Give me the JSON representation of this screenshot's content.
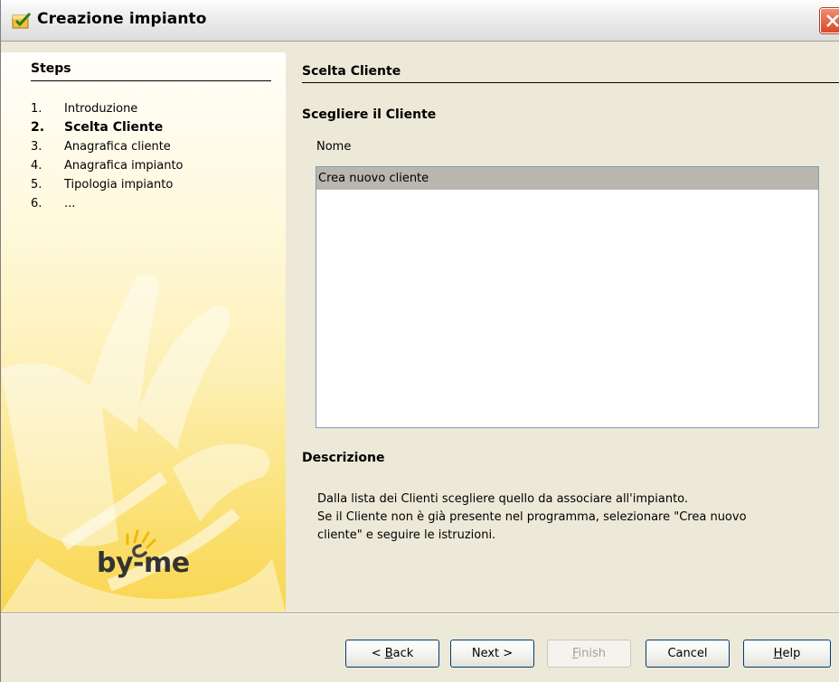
{
  "window": {
    "title": "Creazione impianto"
  },
  "steps": {
    "heading": "Steps",
    "items": [
      {
        "num": "1.",
        "label": "Introduzione",
        "active": false
      },
      {
        "num": "2.",
        "label": "Scelta Cliente",
        "active": true
      },
      {
        "num": "3.",
        "label": "Anagrafica cliente",
        "active": false
      },
      {
        "num": "4.",
        "label": "Anagrafica impianto",
        "active": false
      },
      {
        "num": "5.",
        "label": "Tipologia impianto",
        "active": false
      },
      {
        "num": "6.",
        "label": "...",
        "active": false
      }
    ],
    "logo_text": "by-me"
  },
  "main": {
    "title": "Scelta Cliente",
    "subheading": "Scegliere il Cliente",
    "field_label": "Nome",
    "list_items": [
      {
        "label": "Crea nuovo cliente",
        "selected": true
      }
    ],
    "description_heading": "Descrizione",
    "description_lines": [
      "Dalla lista dei Clienti scegliere quello da associare all'impianto.",
      "Se il Cliente non è già presente nel programma, selezionare \"Crea nuovo",
      "cliente\" e seguire le istruzioni."
    ]
  },
  "buttons": {
    "back": {
      "prefix": "< ",
      "mnemonic": "B",
      "rest": "ack"
    },
    "next": {
      "label": "Next >"
    },
    "finish": {
      "mnemonic": "F",
      "rest": "inish"
    },
    "cancel": {
      "label": "Cancel"
    },
    "help": {
      "mnemonic": "H",
      "rest": "elp"
    }
  },
  "colors": {
    "close_red": "#d9482a",
    "list_selection": "#b8b6ad",
    "panel_yellow": "#f9d650",
    "dialog_bg": "#ece9d8"
  },
  "icons": {
    "app": "checkbox-folder-icon",
    "close": "close-x-icon"
  }
}
